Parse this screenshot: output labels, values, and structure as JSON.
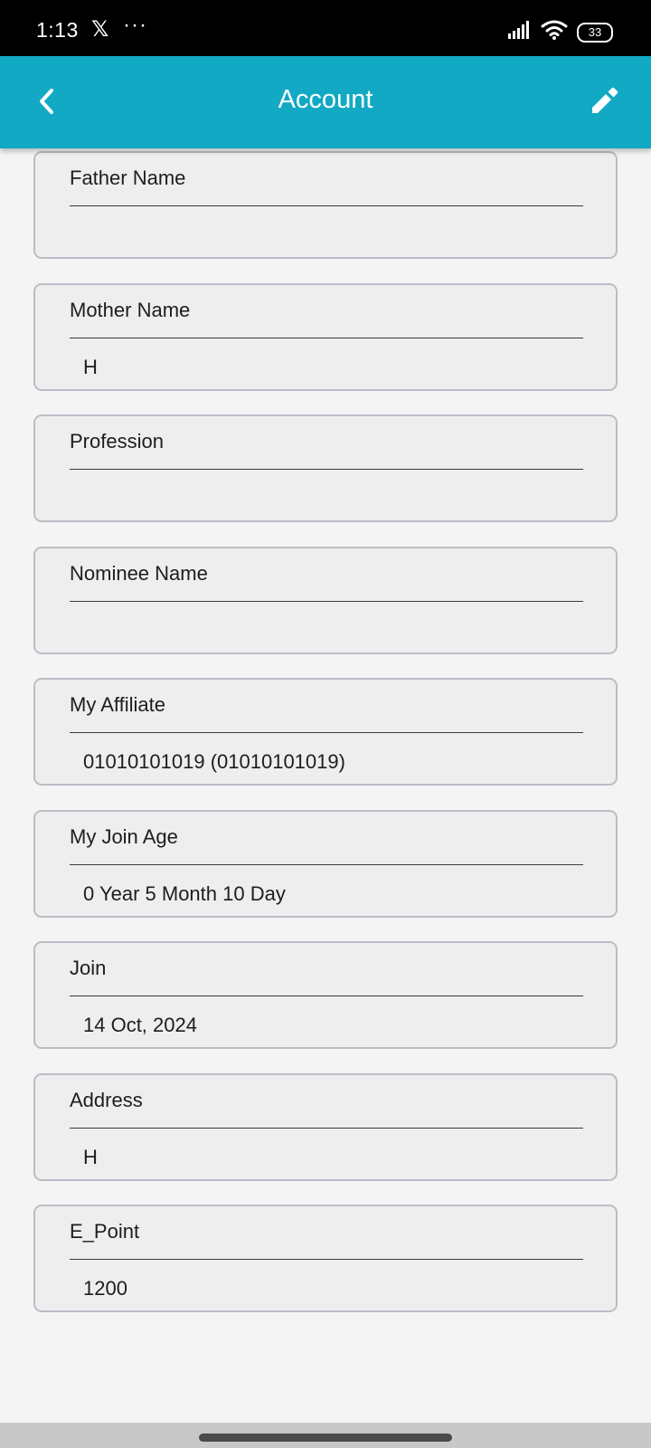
{
  "status_bar": {
    "time": "1:13",
    "x_app": "𝕏",
    "more": "···",
    "battery": "33"
  },
  "app_bar": {
    "title": "Account",
    "back_icon": "chevron-left-icon",
    "edit_icon": "pencil-icon",
    "color": "#12a9c4"
  },
  "fields": [
    {
      "label": "Father Name",
      "value": ""
    },
    {
      "label": "Mother Name",
      "value": "H"
    },
    {
      "label": "Profession",
      "value": ""
    },
    {
      "label": "Nominee Name",
      "value": ""
    },
    {
      "label": "My Affiliate",
      "value": "01010101019 (01010101019)"
    },
    {
      "label": "My Join Age",
      "value": "0 Year 5 Month 10 Day"
    },
    {
      "label": "Join",
      "value": "14 Oct, 2024"
    },
    {
      "label": "Address",
      "value": "H"
    },
    {
      "label": "E_Point",
      "value": "1200"
    }
  ]
}
